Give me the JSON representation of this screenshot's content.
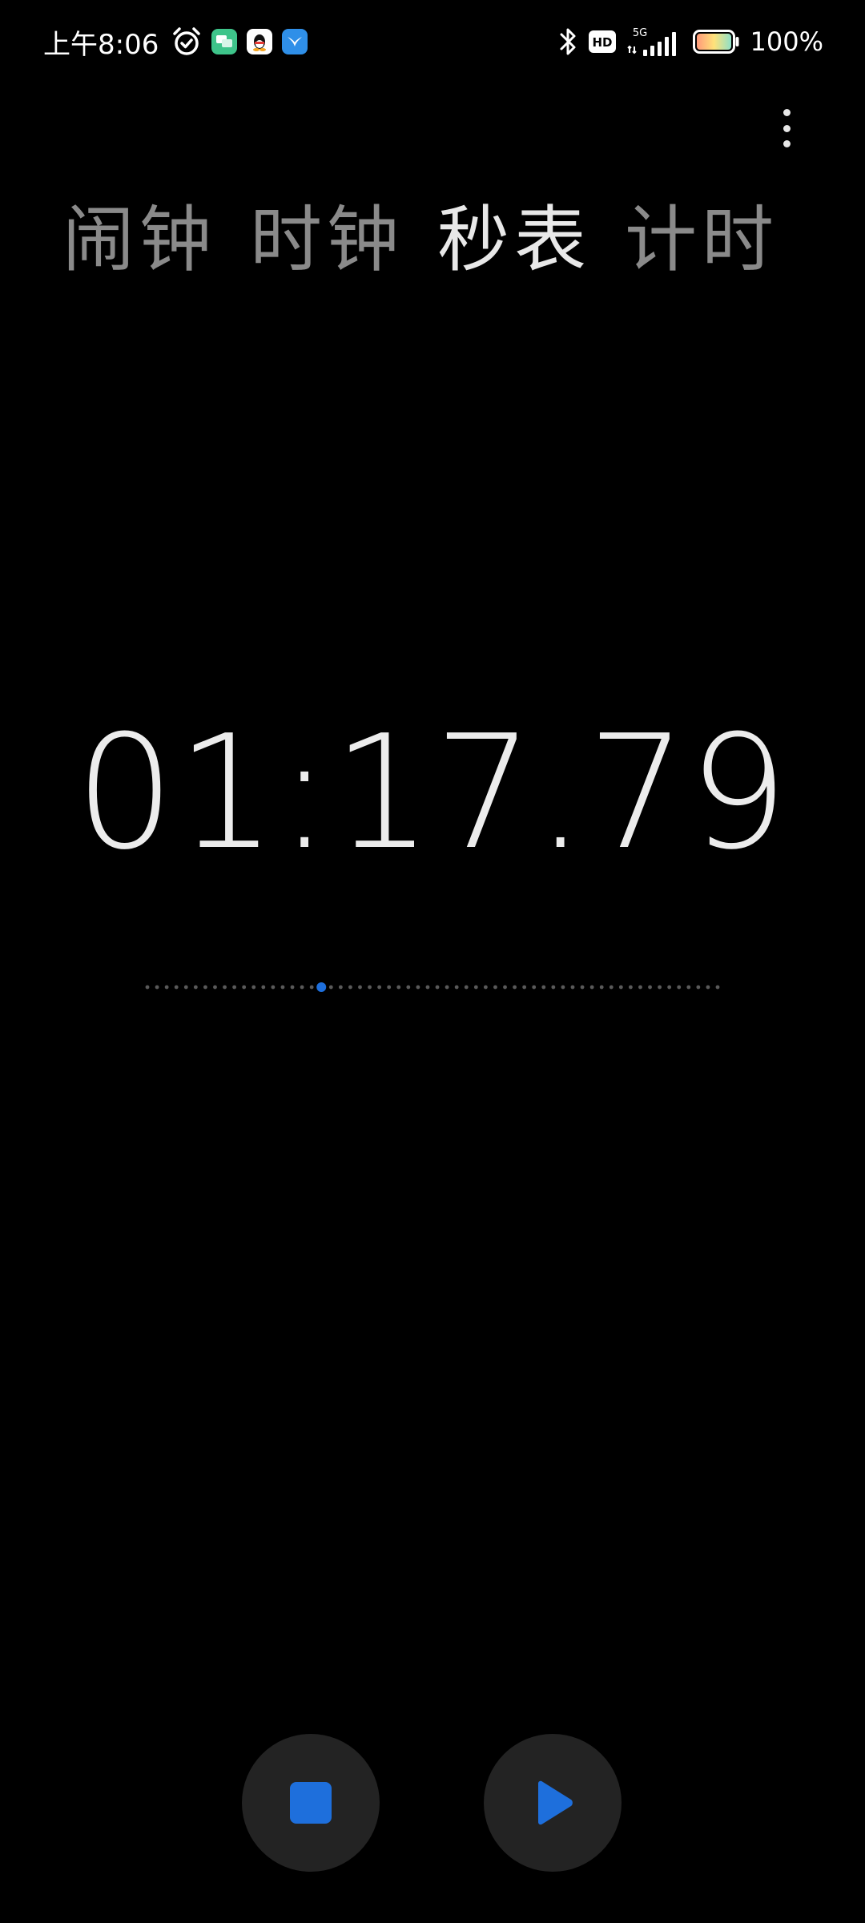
{
  "status_bar": {
    "time": "上午8:06",
    "network": "5G",
    "hd_label": "HD",
    "battery_percent": "100%",
    "battery_level": 1.0,
    "icons": [
      "alarm-icon",
      "messages-app-icon",
      "qq-app-icon",
      "bird-app-icon",
      "bluetooth-icon",
      "hd-icon",
      "signal-icon",
      "battery-icon"
    ]
  },
  "menu": {
    "icon": "more-vertical-icon"
  },
  "tabs": [
    {
      "label": "闹钟",
      "active": false
    },
    {
      "label": "时钟",
      "active": false
    },
    {
      "label": "秒表",
      "active": true
    },
    {
      "label": "计时",
      "active": false
    }
  ],
  "stopwatch": {
    "elapsed": "01:17.79",
    "progress_dot_count": 60,
    "progress_active_index": 18
  },
  "controls": {
    "stop_icon": "stop-icon",
    "play_icon": "play-icon"
  },
  "colors": {
    "background": "#000000",
    "accent": "#1e6fdc",
    "button_bg": "#232323",
    "tab_active": "#e8e8e8",
    "tab_inactive": "#8a8a8a",
    "track_dot": "#5a5a5a"
  }
}
